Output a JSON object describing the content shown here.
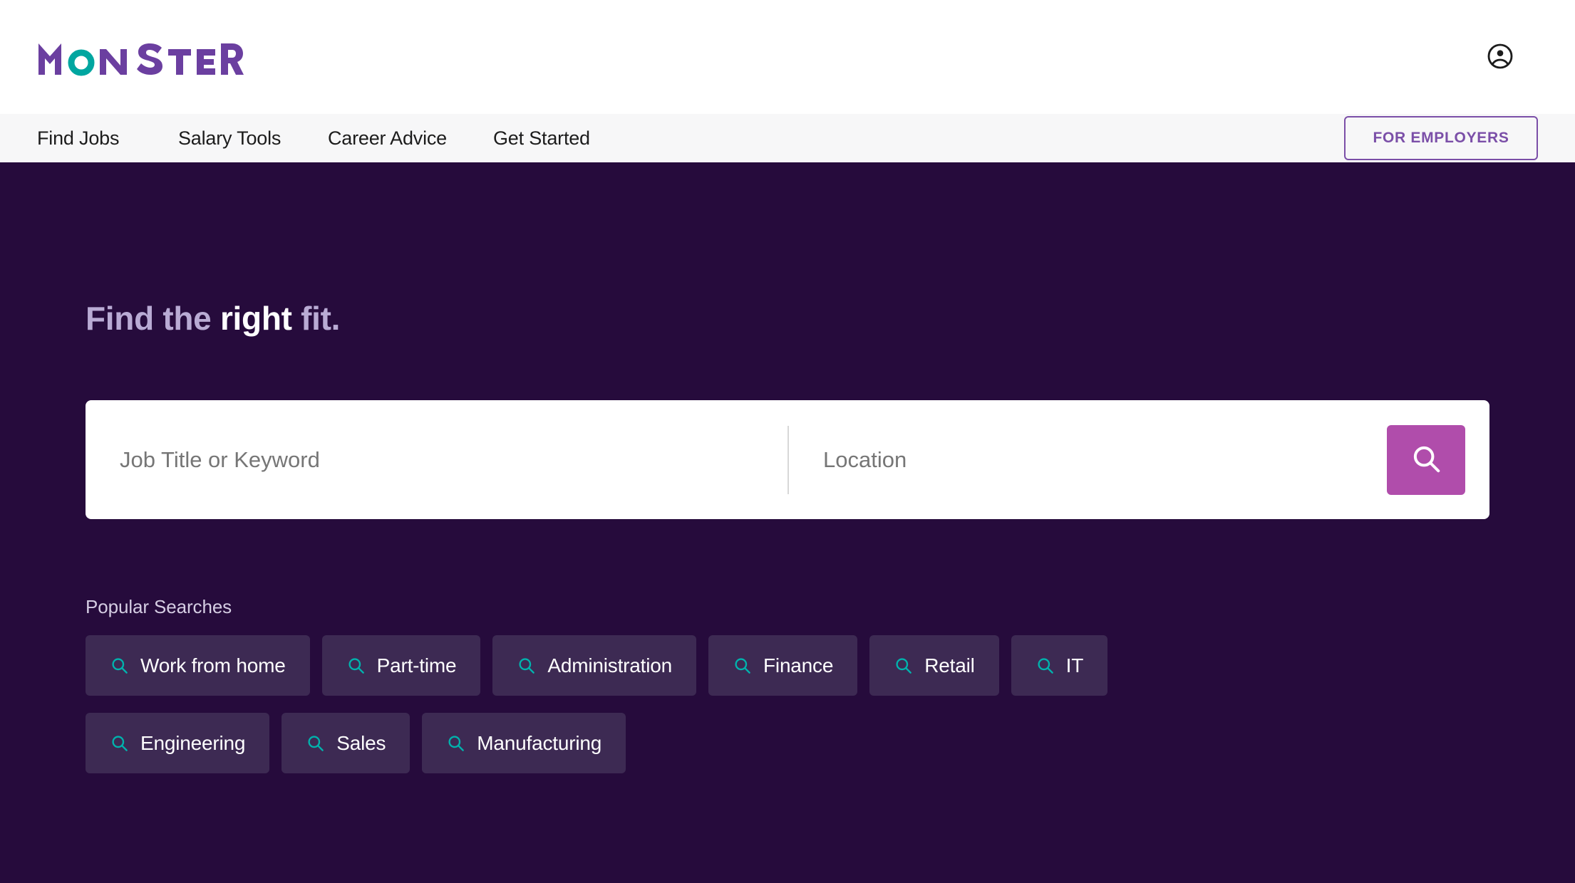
{
  "header": {
    "logo_text": "MONSTER",
    "logo_colors": {
      "purple": "#6b3fa0",
      "teal": "#00a6a0"
    },
    "account_icon": "account-circle-icon"
  },
  "nav": {
    "items": [
      {
        "label": "Find Jobs"
      },
      {
        "label": "Salary Tools"
      },
      {
        "label": "Career Advice"
      },
      {
        "label": "Get Started"
      }
    ],
    "employers_button": "FOR EMPLOYERS",
    "background": "#f7f7f8",
    "accent": "#7b4fa8"
  },
  "hero": {
    "background": "#260b3c",
    "title_prefix": "Find the ",
    "title_accent": "right",
    "title_suffix": " fit.",
    "title_full": "Find the right fit."
  },
  "search": {
    "keyword_placeholder": "Job Title or Keyword",
    "keyword_value": "",
    "location_placeholder": "Location",
    "location_value": "",
    "button_icon": "search-icon",
    "button_color": "#b04dab"
  },
  "popular": {
    "label": "Popular Searches",
    "icon_color": "#00b3ad",
    "chip_background": "#3d2a53",
    "rows": [
      [
        {
          "label": "Work from home",
          "icon": "search-icon"
        },
        {
          "label": "Part-time",
          "icon": "search-icon"
        },
        {
          "label": "Administration",
          "icon": "search-icon"
        },
        {
          "label": "Finance",
          "icon": "search-icon"
        },
        {
          "label": "Retail",
          "icon": "search-icon"
        },
        {
          "label": "IT",
          "icon": "search-icon"
        }
      ],
      [
        {
          "label": "Engineering",
          "icon": "search-icon"
        },
        {
          "label": "Sales",
          "icon": "search-icon"
        },
        {
          "label": "Manufacturing",
          "icon": "search-icon"
        }
      ]
    ]
  }
}
